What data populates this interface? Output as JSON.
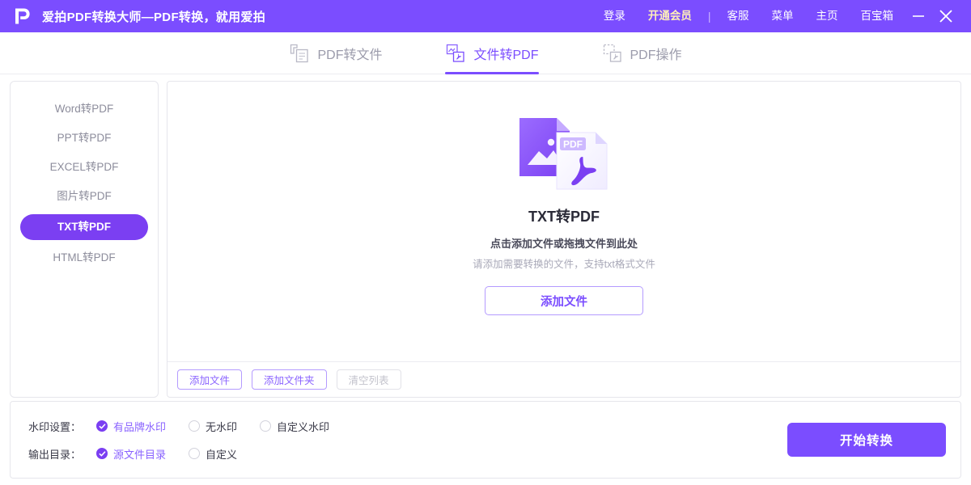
{
  "titlebar": {
    "logo_icon": "aipai-p-logo-icon",
    "app_title": "爱拍PDF转换大师—PDF转换，就用爱拍",
    "nav": [
      {
        "label": "登录",
        "name": "login"
      },
      {
        "label": "开通会员",
        "name": "become-member"
      },
      {
        "label": "客服",
        "name": "customer-service"
      },
      {
        "label": "菜单",
        "name": "menu"
      },
      {
        "label": "主页",
        "name": "home"
      },
      {
        "label": "百宝箱",
        "name": "toolbox"
      }
    ],
    "separator": "|",
    "minimize_icon": "minimize-icon",
    "close_icon": "close-icon",
    "bg_color": "#7b4dff",
    "vip_color": "#fff0b8"
  },
  "tabs": [
    {
      "label": "PDF转文件",
      "icon": "pdf-to-file-icon",
      "active": false
    },
    {
      "label": "文件转PDF",
      "icon": "file-to-pdf-icon",
      "active": true
    },
    {
      "label": "PDF操作",
      "icon": "pdf-operate-icon",
      "active": false
    }
  ],
  "sidebar": {
    "items": [
      {
        "label": "Word转PDF",
        "active": false
      },
      {
        "label": "PPT转PDF",
        "active": false
      },
      {
        "label": "EXCEL转PDF",
        "active": false
      },
      {
        "label": "图片转PDF",
        "active": false
      },
      {
        "label": "TXT转PDF",
        "active": true
      },
      {
        "label": "HTML转PDF",
        "active": false
      }
    ],
    "active_color": "#7b3ff2"
  },
  "dropzone": {
    "icon": "txt-to-pdf-document-icon",
    "title": "TXT转PDF",
    "hint_primary": "点击添加文件或拖拽文件到此处",
    "hint_secondary": "请添加需要转换的文件，支持txt格式文件",
    "add_file_label": "添加文件"
  },
  "panel_toolbar": {
    "add_file_label": "添加文件",
    "add_folder_label": "添加文件夹",
    "clear_list_label": "清空列表",
    "clear_list_disabled": true
  },
  "footer": {
    "watermark": {
      "label": "水印设置：",
      "options": [
        {
          "label": "有品牌水印",
          "selected": true
        },
        {
          "label": "无水印",
          "selected": false
        },
        {
          "label": "自定义水印",
          "selected": false
        }
      ]
    },
    "output": {
      "label": "输出目录：",
      "options": [
        {
          "label": "源文件目录",
          "selected": true
        },
        {
          "label": "自定义",
          "selected": false
        }
      ]
    },
    "start_label": "开始转换",
    "start_color": "#7b4dff"
  }
}
